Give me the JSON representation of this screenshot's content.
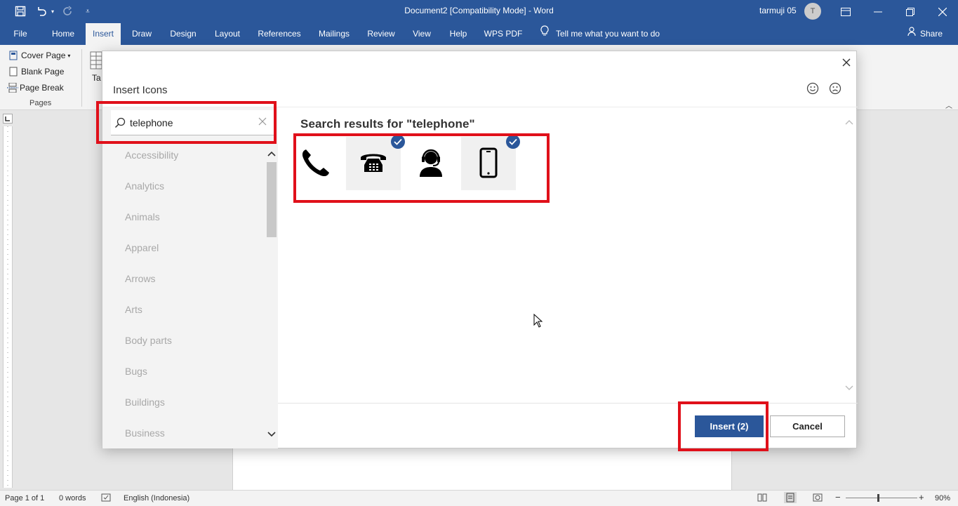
{
  "titlebar": {
    "doc_title": "Document2 [Compatibility Mode]  -  Word",
    "user_name": "tarmuji 05",
    "avatar_initial": "T"
  },
  "tabs": [
    "File",
    "Home",
    "Insert",
    "Draw",
    "Design",
    "Layout",
    "References",
    "Mailings",
    "Review",
    "View",
    "Help",
    "WPS PDF"
  ],
  "active_tab": "Insert",
  "tell_me": "Tell me what you want to do",
  "share": "Share",
  "ribbon": {
    "cover_page": "Cover Page",
    "blank_page": "Blank Page",
    "page_break": "Page Break",
    "group_label": "Pages",
    "next_group_partial": "Ta"
  },
  "dialog": {
    "title": "Insert Icons",
    "search": {
      "value": "telephone",
      "placeholder": "Search"
    },
    "categories": [
      "Accessibility",
      "Analytics",
      "Animals",
      "Apparel",
      "Arrows",
      "Arts",
      "Body parts",
      "Bugs",
      "Buildings",
      "Business"
    ],
    "results_title": "Search results for \"telephone\"",
    "results": [
      {
        "icon": "phone-handset-icon",
        "selected": false
      },
      {
        "icon": "desk-telephone-icon",
        "selected": true
      },
      {
        "icon": "call-center-agent-icon",
        "selected": false
      },
      {
        "icon": "mobile-phone-icon",
        "selected": true
      }
    ],
    "insert_label": "Insert (2)",
    "cancel_label": "Cancel"
  },
  "statusbar": {
    "page": "Page 1 of 1",
    "words": "0 words",
    "language": "English (Indonesia)",
    "zoom": "90%"
  },
  "colors": {
    "accent": "#2b579a",
    "highlight": "#e0101a"
  }
}
